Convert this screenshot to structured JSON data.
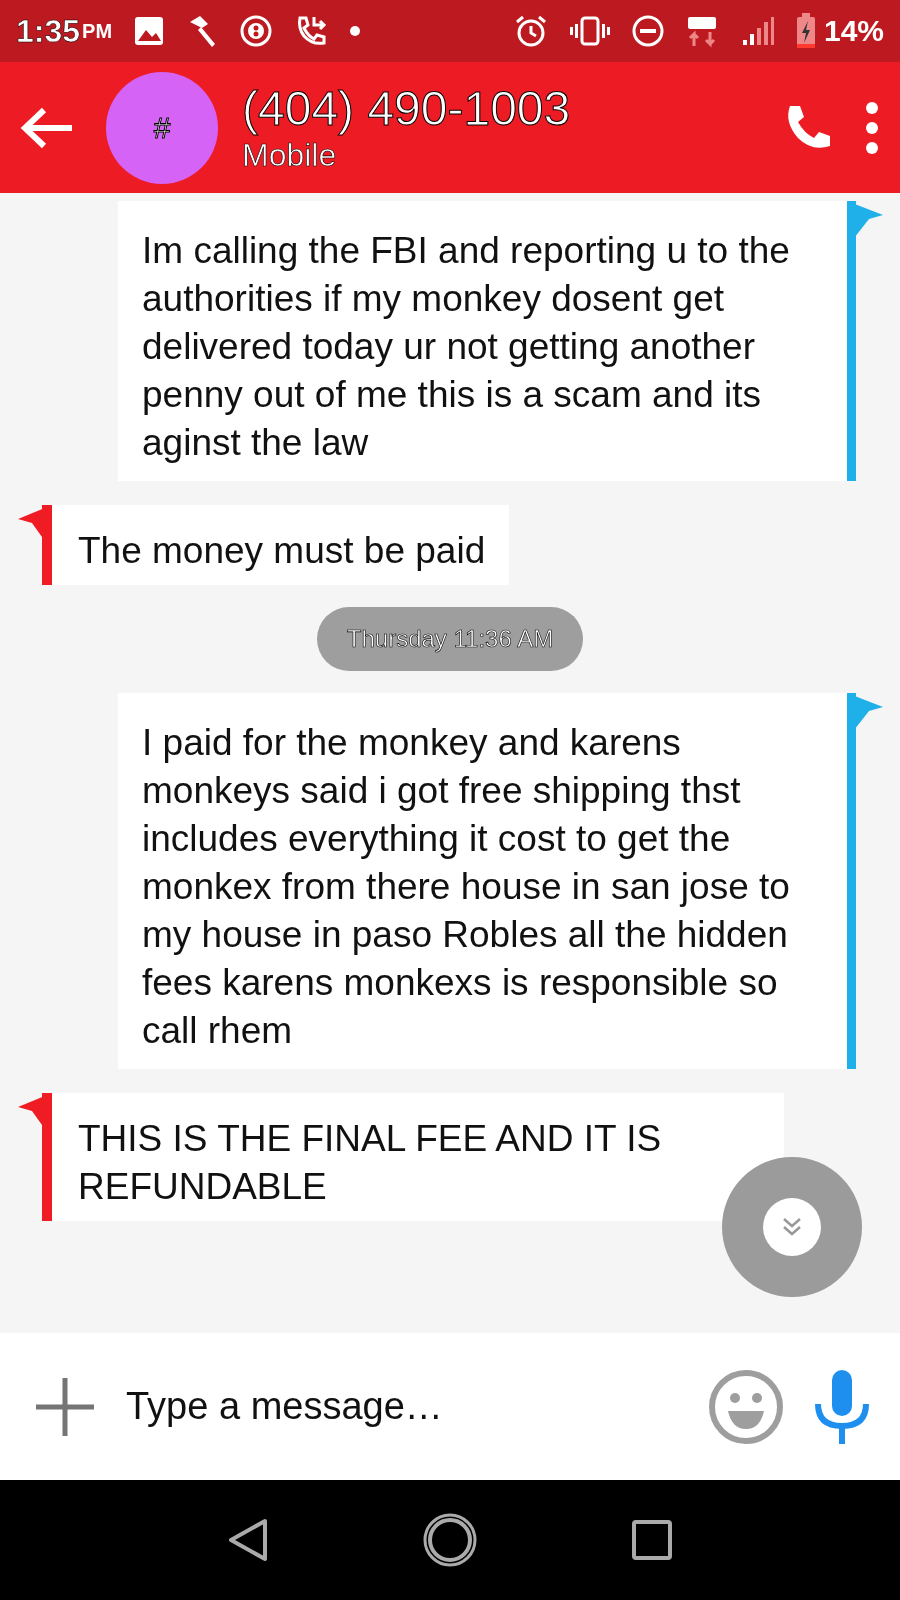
{
  "status_bar": {
    "time": "1:35",
    "ampm": "PM",
    "battery": "14%"
  },
  "header": {
    "avatar": "#",
    "title": "(404) 490-1003",
    "subtitle": "Mobile"
  },
  "messages": [
    {
      "kind": "outgoing",
      "text": "Im calling the FBI and reporting u to the authorities if my monkey dosent get delivered today ur not getting another penny out of me this is a scam and its aginst the law"
    },
    {
      "kind": "incoming",
      "text": "The money must be paid"
    },
    {
      "kind": "timestamp",
      "text": "Thursday 11:36 AM"
    },
    {
      "kind": "outgoing",
      "text": "I paid for the monkey and karens monkeys said i got free shipping thst includes everything it cost to get the monkex from there house in san jose to my house in paso Robles all the hidden fees karens monkexs is responsible so call rhem"
    },
    {
      "kind": "incoming",
      "text": "THIS IS THE FINAL FEE AND IT IS REFUNDABLE"
    }
  ],
  "composer": {
    "placeholder": "Type a message…"
  }
}
